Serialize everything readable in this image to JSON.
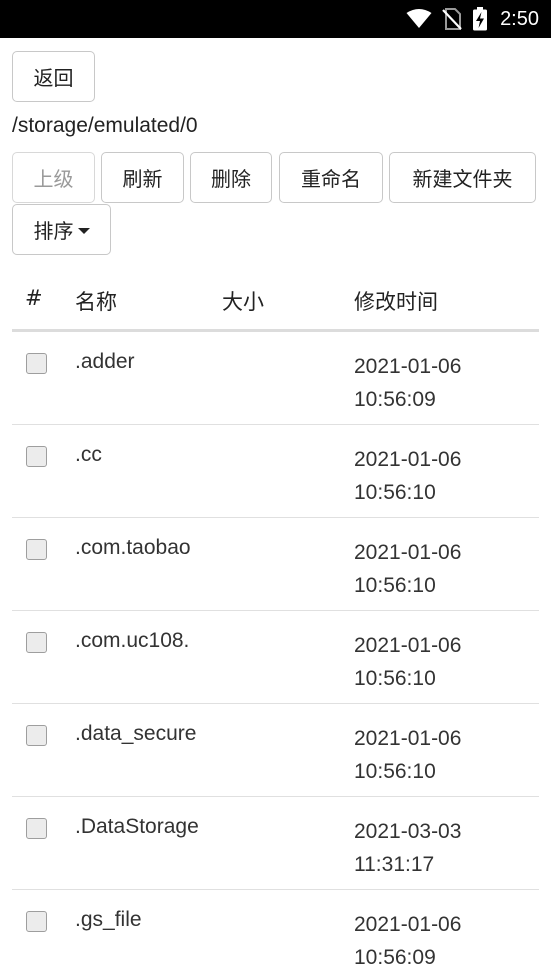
{
  "status_bar": {
    "time": "2:50"
  },
  "toolbar": {
    "back_label": "返回",
    "path": "/storage/emulated/0",
    "up_label": "上级",
    "refresh_label": "刷新",
    "delete_label": "删除",
    "rename_label": "重命名",
    "new_folder_label": "新建文件夹",
    "sort_label": "排序"
  },
  "table": {
    "headers": {
      "index": "#",
      "name": "名称",
      "size": "大小",
      "modified": "修改时间"
    },
    "rows": [
      {
        "name": ".adder",
        "size": "",
        "date": "2021-01-06",
        "time": "10:56:09"
      },
      {
        "name": ".cc",
        "size": "",
        "date": "2021-01-06",
        "time": "10:56:10"
      },
      {
        "name": ".com.taobao",
        "size": "",
        "date": "2021-01-06",
        "time": "10:56:10"
      },
      {
        "name": ".com.uc108.",
        "size": "",
        "date": "2021-01-06",
        "time": "10:56:10"
      },
      {
        "name": ".data_secure",
        "size": "",
        "date": "2021-01-06",
        "time": "10:56:10"
      },
      {
        "name": ".DataStorage",
        "size": "",
        "date": "2021-03-03",
        "time": "11:31:17"
      },
      {
        "name": ".gs_file",
        "size": "",
        "date": "2021-01-06",
        "time": "10:56:09"
      }
    ]
  }
}
